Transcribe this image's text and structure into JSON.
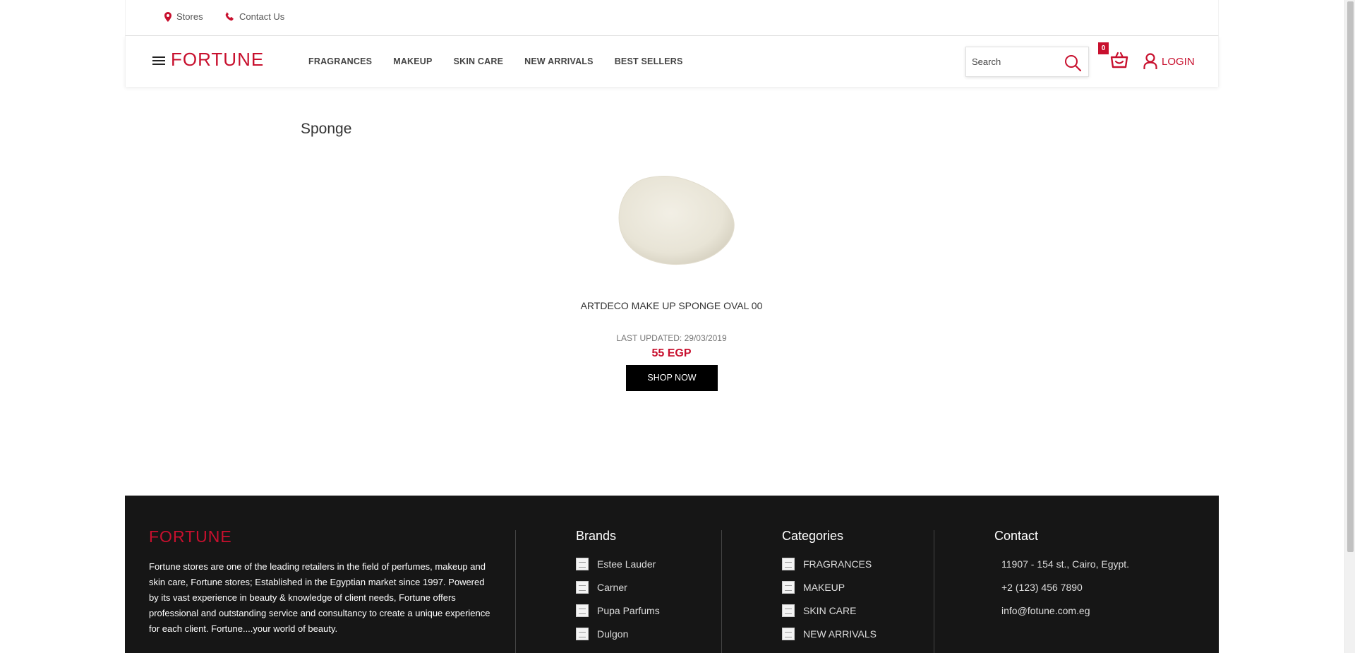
{
  "topbar": {
    "stores_label": "Stores",
    "contact_label": "Contact Us"
  },
  "header": {
    "logo": "FORTUNE",
    "nav": [
      "FRAGRANCES",
      "MAKEUP",
      "SKIN CARE",
      "NEW ARRIVALS",
      "BEST SELLERS"
    ],
    "search_placeholder": "Search",
    "cart_count": "0",
    "login_label": "LOGIN"
  },
  "main": {
    "page_title": "Sponge",
    "product": {
      "name": "ARTDECO MAKE UP SPONGE OVAL 00",
      "last_updated": "LAST UPDATED: 29/03/2019",
      "price": "55 EGP",
      "button_label": "SHOP NOW"
    }
  },
  "footer": {
    "logo": "FORTUNE",
    "about": "Fortune stores are one of the leading retailers in the field of perfumes, makeup and skin care, Fortune stores; Established in the Egyptian market since 1997. Powered by its vast experience in beauty & knowledge of client needs, Fortune offers professional and outstanding service and consultancy to create a unique experience for each client. Fortune....your world of beauty.",
    "brands": {
      "title": "Brands",
      "items": [
        "Estee Lauder",
        "Carner",
        "Pupa Parfums",
        "Dulgon"
      ]
    },
    "categories": {
      "title": "Categories",
      "items": [
        "FRAGRANCES",
        "MAKEUP",
        "SKIN CARE",
        "NEW ARRIVALS"
      ]
    },
    "contact": {
      "title": "Contact",
      "address": "11907 - 154 st., Cairo, Egypt.",
      "phone": "+2 (123) 456 7890",
      "email": "info@fotune.com.eg"
    }
  },
  "colors": {
    "brand_red": "#c8102e",
    "footer_bg": "#161616"
  }
}
